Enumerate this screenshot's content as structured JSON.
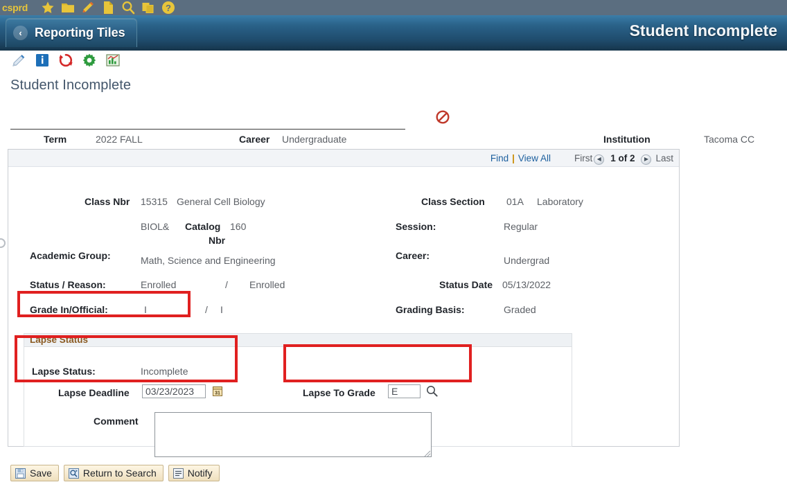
{
  "topbar": {
    "brand": "csprd",
    "icons": [
      {
        "name": "favorites-star-icon",
        "glyph": "star"
      },
      {
        "name": "folder-icon",
        "glyph": "folder"
      },
      {
        "name": "edit-pencil-icon",
        "glyph": "pencil"
      },
      {
        "name": "new-document-icon",
        "glyph": "page"
      },
      {
        "name": "search-icon",
        "glyph": "magnifier"
      },
      {
        "name": "copy-icon",
        "glyph": "copy"
      },
      {
        "name": "help-icon",
        "glyph": "question"
      }
    ]
  },
  "header": {
    "breadcrumb_label": "Reporting Tiles",
    "back_glyph": "‹",
    "title": "Student Incomplete"
  },
  "pagetools": [
    {
      "name": "personalize-icon",
      "glyph": "pencil-blue"
    },
    {
      "name": "info-icon",
      "glyph": "info"
    },
    {
      "name": "refresh-icon",
      "glyph": "refresh"
    },
    {
      "name": "settings-gear-icon",
      "glyph": "gear"
    },
    {
      "name": "chart-icon",
      "glyph": "chart"
    }
  ],
  "page": {
    "title": "Student Incomplete",
    "status_icon": "no-entry-icon"
  },
  "keyfields": {
    "term_label": "Term",
    "term_value": "2022 FALL",
    "career_label": "Career",
    "career_value": "Undergraduate",
    "institution_label": "Institution",
    "institution_value": "Tacoma CC"
  },
  "rownav": {
    "find": "Find",
    "separator": "|",
    "view_all": "View All",
    "first": "First",
    "counter": "1 of 2",
    "last": "Last",
    "prev_glyph": "◀",
    "next_glyph": "▶"
  },
  "detail": {
    "class_nbr_label": "Class Nbr",
    "class_nbr_value": "15315",
    "class_title": "General Cell Biology",
    "subject_value": "BIOL&",
    "catalog_nbr_label_1": "Catalog",
    "catalog_nbr_label_2": "Nbr",
    "catalog_nbr_value": "160",
    "academic_group_label": "Academic Group:",
    "academic_group_value": "Math, Science and Engineering",
    "status_reason_label": "Status / Reason:",
    "status_value": "Enrolled",
    "status_reason_sep": "/",
    "reason_value": "Enrolled",
    "grade_label": "Grade In/Official:",
    "grade_in_value": "I",
    "grade_sep": "/",
    "grade_official_value": "I",
    "class_section_label": "Class Section",
    "class_section_value": "01A",
    "class_component_value": "Laboratory",
    "session_label": "Session:",
    "session_value": "Regular",
    "career_label": "Career:",
    "career_value": "Undergrad",
    "status_date_label": "Status Date",
    "status_date_value": "05/13/2022",
    "grading_basis_label": "Grading Basis:",
    "grading_basis_value": "Graded"
  },
  "lapse": {
    "group_title": "Lapse Status",
    "status_label": "Lapse Status:",
    "status_value": "Incomplete",
    "deadline_label": "Lapse Deadline",
    "deadline_value": "03/23/2023",
    "calendar_icon": "calendar-icon",
    "to_grade_label": "Lapse To Grade",
    "to_grade_value": "E",
    "lookup_icon": "magnifier-lookup-icon",
    "comment_label": "Comment",
    "comment_value": "",
    "comment_placeholder": ""
  },
  "buttons": [
    {
      "name": "save-button",
      "label": "Save",
      "icon": "floppy-disk-icon"
    },
    {
      "name": "return-to-search-button",
      "label": "Return to Search",
      "icon": "search-return-icon"
    },
    {
      "name": "notify-button",
      "label": "Notify",
      "icon": "notify-icon"
    }
  ],
  "colors": {
    "header_blue_top": "#3b7da8",
    "header_blue_bottom": "#16354b",
    "accent_link": "#1c5f9e",
    "group_title_brown": "#8a5a22",
    "annotation_red": "#e02020",
    "topbar_gray": "#5b6e80",
    "topbar_yellow": "#e8c53a"
  },
  "annotations": [
    {
      "name": "annotation-grade-in-official"
    },
    {
      "name": "annotation-lapse-status"
    },
    {
      "name": "annotation-lapse-to-grade"
    }
  ]
}
